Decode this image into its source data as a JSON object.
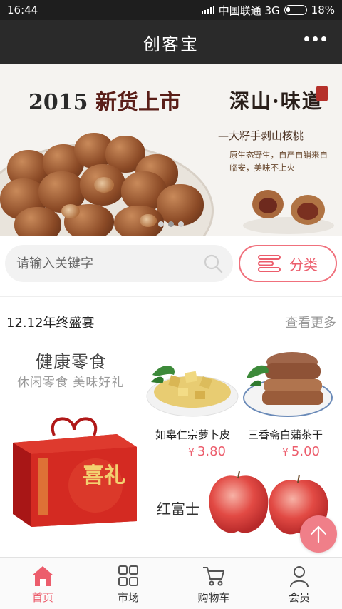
{
  "status_bar": {
    "time": "16:44",
    "carrier": "中国联通 3G",
    "battery": "18%"
  },
  "header": {
    "title": "创客宝",
    "more_icon": "more-dots-icon"
  },
  "banner": {
    "headline_year": "2015",
    "headline_text": "新货上市",
    "brand": "深山·味道",
    "tagline": "—大籽手剥山核桃",
    "description": "原生态野生，自产自销来自临安，美味不上火",
    "dots": 3,
    "active_dot": 1
  },
  "search": {
    "placeholder": "请输入关键字",
    "icon": "search-icon"
  },
  "category": {
    "label": "分类",
    "icon": "menu-lines-icon"
  },
  "section": {
    "title": "12.12年终盛宴",
    "more": "查看更多"
  },
  "promo": {
    "title": "健康零食",
    "subtitle": "休闲零食  美味好礼",
    "gift_text": "喜礼"
  },
  "products": [
    {
      "name": "如皋仁宗萝卜皮",
      "currency": "¥",
      "price": "3.80"
    },
    {
      "name": "三香斋白蒲茶干",
      "currency": "¥",
      "price": "5.00"
    }
  ],
  "featured": {
    "label": "红富士"
  },
  "bottom_nav": [
    {
      "label": "首页",
      "icon": "home-icon",
      "active": true
    },
    {
      "label": "市场",
      "icon": "grid-icon",
      "active": false
    },
    {
      "label": "购物车",
      "icon": "cart-icon",
      "active": false
    },
    {
      "label": "会员",
      "icon": "user-icon",
      "active": false
    }
  ],
  "colors": {
    "accent": "#ec5d6c",
    "header_bg": "#2a2a2a",
    "status_bg": "#1e1e1e"
  }
}
